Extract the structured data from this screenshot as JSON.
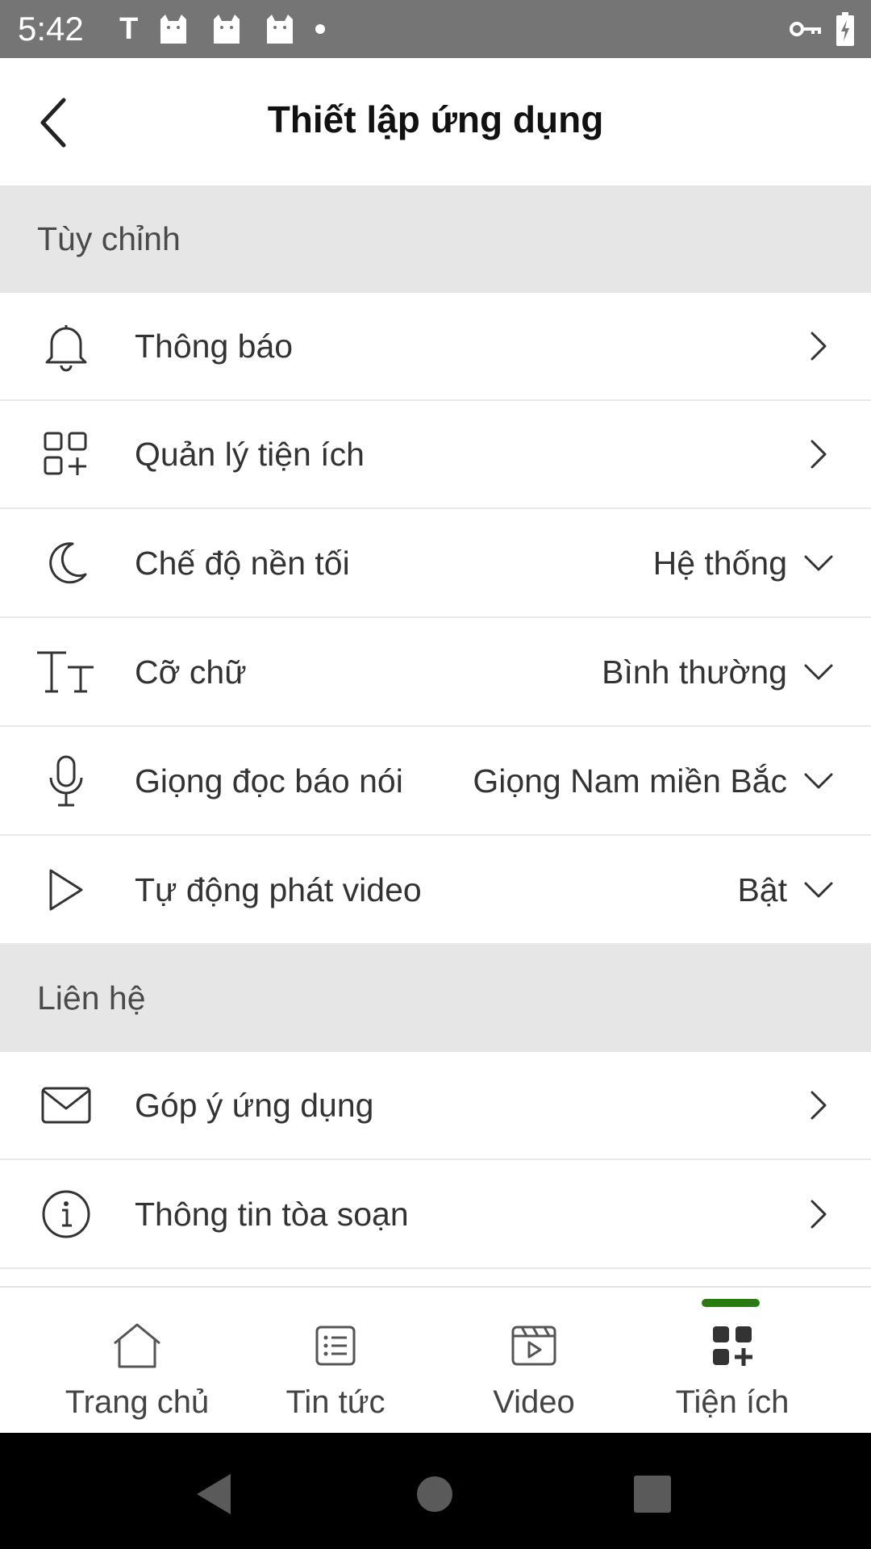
{
  "status_bar": {
    "time": "5:42",
    "left_icons": [
      "t-notification-icon",
      "cat-notification-icon",
      "cat-notification-icon",
      "cat-notification-icon",
      "dot-icon"
    ],
    "right_icons": [
      "vpn-key-icon",
      "battery-charging-icon"
    ]
  },
  "header": {
    "title": "Thiết lập ứng dụng"
  },
  "sections": [
    {
      "title": "Tùy chỉnh",
      "items": [
        {
          "label": "Thông báo",
          "icon": "bell-icon",
          "control": "chevron-right"
        },
        {
          "label": "Quản lý tiện ích",
          "icon": "widgets-icon",
          "control": "chevron-right"
        },
        {
          "label": "Chế độ nền tối",
          "icon": "moon-icon",
          "value": "Hệ thống",
          "control": "chevron-down"
        },
        {
          "label": "Cỡ chữ",
          "icon": "text-size-icon",
          "value": "Bình thường",
          "control": "chevron-down"
        },
        {
          "label": "Giọng đọc báo nói",
          "icon": "microphone-icon",
          "value": "Giọng Nam miền Bắc",
          "control": "chevron-down"
        },
        {
          "label": "Tự động phát video",
          "icon": "play-icon",
          "value": "Bật",
          "control": "chevron-down"
        }
      ]
    },
    {
      "title": "Liên hệ",
      "items": [
        {
          "label": "Góp ý ứng dụng",
          "icon": "mail-icon",
          "control": "chevron-right"
        },
        {
          "label": "Thông tin tòa soạn",
          "icon": "info-icon",
          "control": "chevron-right"
        }
      ]
    }
  ],
  "bottom_nav": {
    "items": [
      {
        "label": "Trang chủ",
        "icon": "home-icon"
      },
      {
        "label": "Tin tức",
        "icon": "news-list-icon"
      },
      {
        "label": "Video",
        "icon": "video-icon"
      },
      {
        "label": "Tiện ích",
        "icon": "widgets-icon",
        "active": true
      }
    ],
    "active_color": "#2a7a12"
  }
}
